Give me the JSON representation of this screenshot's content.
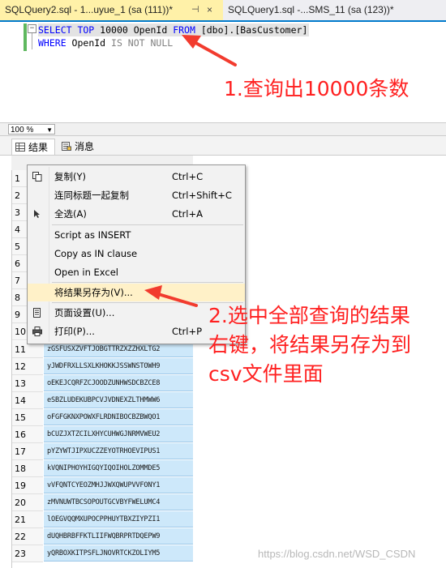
{
  "tabs": [
    {
      "label": "SQLQuery2.sql - 1...uyue_1 (sa (111))*",
      "pin": "⊣",
      "close": "×",
      "active": true
    },
    {
      "label": "SQLQuery1.sql -...SMS_11 (sa (123))*",
      "active": false
    }
  ],
  "editor": {
    "collapse_glyph": "−",
    "line1": {
      "kw1": "SELECT TOP",
      "num": " 10000 ",
      "col": "OpenId ",
      "kw2": "FROM",
      "obj": " [dbo].[BasCustomer]"
    },
    "line2": {
      "kw1": "WHERE",
      "col": " OpenId ",
      "rest": "IS NOT NULL"
    }
  },
  "annotations": {
    "a1": "1.查询出10000条数",
    "a2_l1": "2.选中全部查询的结果",
    "a2_l2": "右键，将结果另存为到",
    "a2_l3": "csv文件里面"
  },
  "zoom": {
    "value": "100 %",
    "arrow": "▼"
  },
  "result_tabs": {
    "results": "结果",
    "messages": "消息"
  },
  "rows": [
    {
      "n": "1",
      "v": ""
    },
    {
      "n": "2",
      "v": ""
    },
    {
      "n": "3",
      "v": ""
    },
    {
      "n": "4",
      "v": ""
    },
    {
      "n": "5",
      "v": ""
    },
    {
      "n": "6",
      "v": ""
    },
    {
      "n": "7",
      "v": ""
    },
    {
      "n": "8",
      "v": ""
    },
    {
      "n": "9",
      "v": ""
    },
    {
      "n": "10",
      "v": ""
    },
    {
      "n": "11",
      "v": "zGSFUSXZVFTJOBGTTRZXZZHXLTG2"
    },
    {
      "n": "12",
      "v": "yJWDFRXLLSXLKHOKKJSSWNSTOWH9"
    },
    {
      "n": "13",
      "v": "oEKEJCQRFZCJOODZUNHWSDCBZCE8"
    },
    {
      "n": "14",
      "v": "eSBZLUDEKUBPCVJVDNEXZLTHMWW6"
    },
    {
      "n": "15",
      "v": "oFGFGKNXPOWXFLRDNIBOCBZBWQO1"
    },
    {
      "n": "16",
      "v": "bCUZJXTZCILXHYCUHWGJNRMVWEU2"
    },
    {
      "n": "17",
      "v": "pYZYWTJIPXUCZZEYOTRHOEVIPUS1"
    },
    {
      "n": "18",
      "v": "kVQNIPHOYHIGQYIQOIHOLZOMMDE5"
    },
    {
      "n": "19",
      "v": "vVFQNTCYEOZMHJJWXQWUPVVFONY1"
    },
    {
      "n": "20",
      "v": "zMVNUWTBCSOPOUTGCVBYFWELUMC4"
    },
    {
      "n": "21",
      "v": "lOEGVQQMXUPOCPPHUYTBXZIYPZI1"
    },
    {
      "n": "22",
      "v": "dUQHBRBFFKTLIIFWQBRPRTDQEPW9"
    },
    {
      "n": "23",
      "v": "yQRBOXKITPSFLJNOVRTCKZOLIYM5"
    }
  ],
  "menu": {
    "copy": {
      "label": "复制(Y)",
      "shortcut": "Ctrl+C",
      "icon": "copy-icon"
    },
    "copy_headers": {
      "label": "连同标题一起复制",
      "shortcut": "Ctrl+Shift+C"
    },
    "select_all": {
      "label": "全选(A)",
      "shortcut": "Ctrl+A",
      "icon": "select-all-icon"
    },
    "script_insert": {
      "label": "Script as INSERT"
    },
    "copy_in": {
      "label": "Copy as IN clause"
    },
    "open_excel": {
      "label": "Open in Excel"
    },
    "save_as": {
      "label": "将结果另存为(V)..."
    },
    "page_setup": {
      "label": "页面设置(U)...",
      "icon": "page-setup-icon"
    },
    "print": {
      "label": "打印(P)...",
      "shortcut": "Ctrl+P",
      "icon": "printer-icon"
    }
  },
  "watermark": "https://blog.csdn.net/WSD_CSDN",
  "colors": {
    "annotation": "#ff2020",
    "active_tab": "#fff1a8",
    "selection": "#cde8fa",
    "menu_highlight": "#fff1c8"
  }
}
